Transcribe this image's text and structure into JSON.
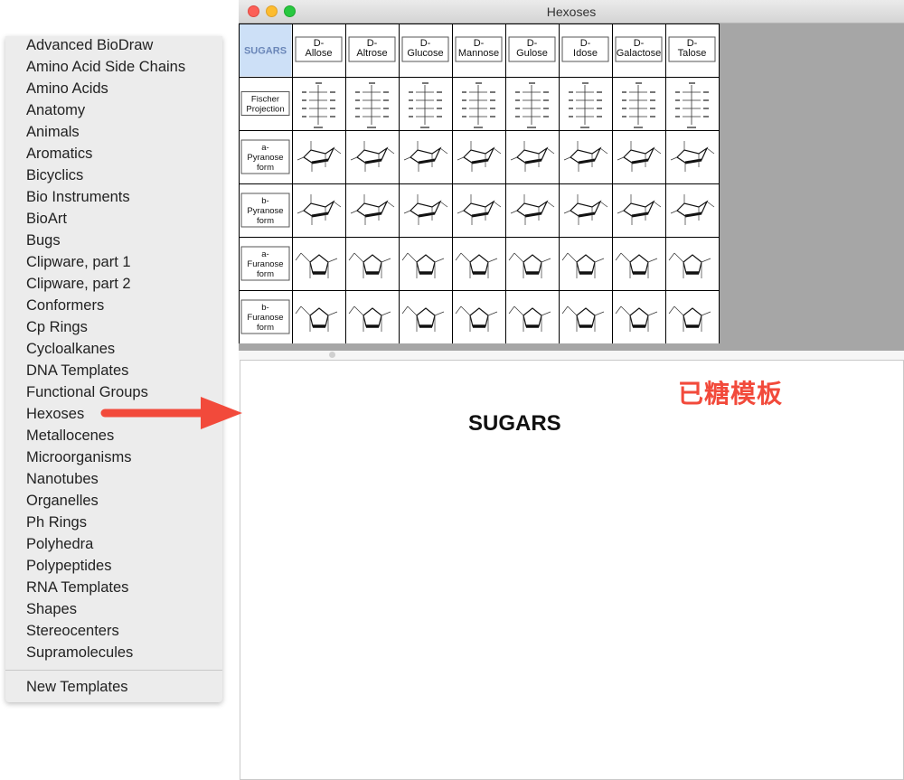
{
  "window": {
    "title": "Hexoses"
  },
  "menu": {
    "items": [
      "Advanced BioDraw",
      "Amino Acid Side Chains",
      "Amino Acids",
      "Anatomy",
      "Animals",
      "Aromatics",
      "Bicyclics",
      "Bio Instruments",
      "BioArt",
      "Bugs",
      "Clipware, part 1",
      "Clipware, part 2",
      "Conformers",
      "Cp Rings",
      "Cycloalkanes",
      "DNA Templates",
      "Functional Groups",
      "Hexoses",
      "Metallocenes",
      "Microorganisms",
      "Nanotubes",
      "Organelles",
      "Ph Rings",
      "Polyhedra",
      "Polypeptides",
      "RNA Templates",
      "Shapes",
      "Stereocenters",
      "Supramolecules"
    ],
    "footer_item": "New Templates"
  },
  "grid": {
    "corner_label": "SUGARS",
    "columns": [
      [
        "D-",
        "Allose"
      ],
      [
        "D-",
        "Altrose"
      ],
      [
        "D-",
        "Glucose"
      ],
      [
        "D-",
        "Mannose"
      ],
      [
        "D-",
        "Gulose"
      ],
      [
        "D-",
        "Idose"
      ],
      [
        "D-",
        "Galactose"
      ],
      [
        "D-",
        "Talose"
      ]
    ],
    "rows": [
      [
        "Fischer",
        "Projection"
      ],
      [
        "a-",
        "Pyranose",
        "form"
      ],
      [
        "b-",
        "Pyranose",
        "form"
      ],
      [
        "a-",
        "Furanose",
        "form"
      ],
      [
        "b-",
        "Furanose",
        "form"
      ]
    ]
  },
  "canvas": {
    "title": "SUGARS"
  },
  "annotation": {
    "text": "已糖模板"
  },
  "colors": {
    "corner_bg": "#cde0f7",
    "corner_text": "#6a86b8",
    "arrow": "#f24a3b",
    "grid_bg": "#a6a6a6"
  },
  "icons": {
    "arrow": "arrow-right-icon"
  }
}
